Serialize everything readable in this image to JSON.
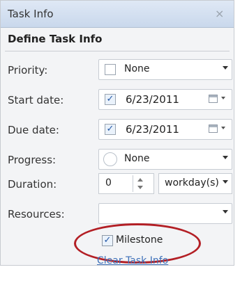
{
  "window": {
    "title": "Task Info",
    "close_symbol": "×"
  },
  "section": {
    "title": "Define Task Info"
  },
  "fields": {
    "priority": {
      "label": "Priority:",
      "value": "None",
      "icon": "checkbox-square-icon"
    },
    "start_date": {
      "label": "Start date:",
      "value": "6/23/2011",
      "checked": true
    },
    "due_date": {
      "label": "Due date:",
      "value": "6/23/2011",
      "checked": true
    },
    "progress": {
      "label": "Progress:",
      "value": "None",
      "icon": "progress-circle-icon"
    },
    "duration": {
      "label": "Duration:",
      "value": "0",
      "unit": "workday(s)"
    },
    "resources": {
      "label": "Resources:",
      "value": ""
    }
  },
  "milestone": {
    "label": "Milestone",
    "checked": true
  },
  "clear_link": {
    "label": "Clear Task Info"
  },
  "colors": {
    "accent": "#2458a6",
    "highlight_oval": "#b31f25",
    "link": "#3e70b9"
  }
}
